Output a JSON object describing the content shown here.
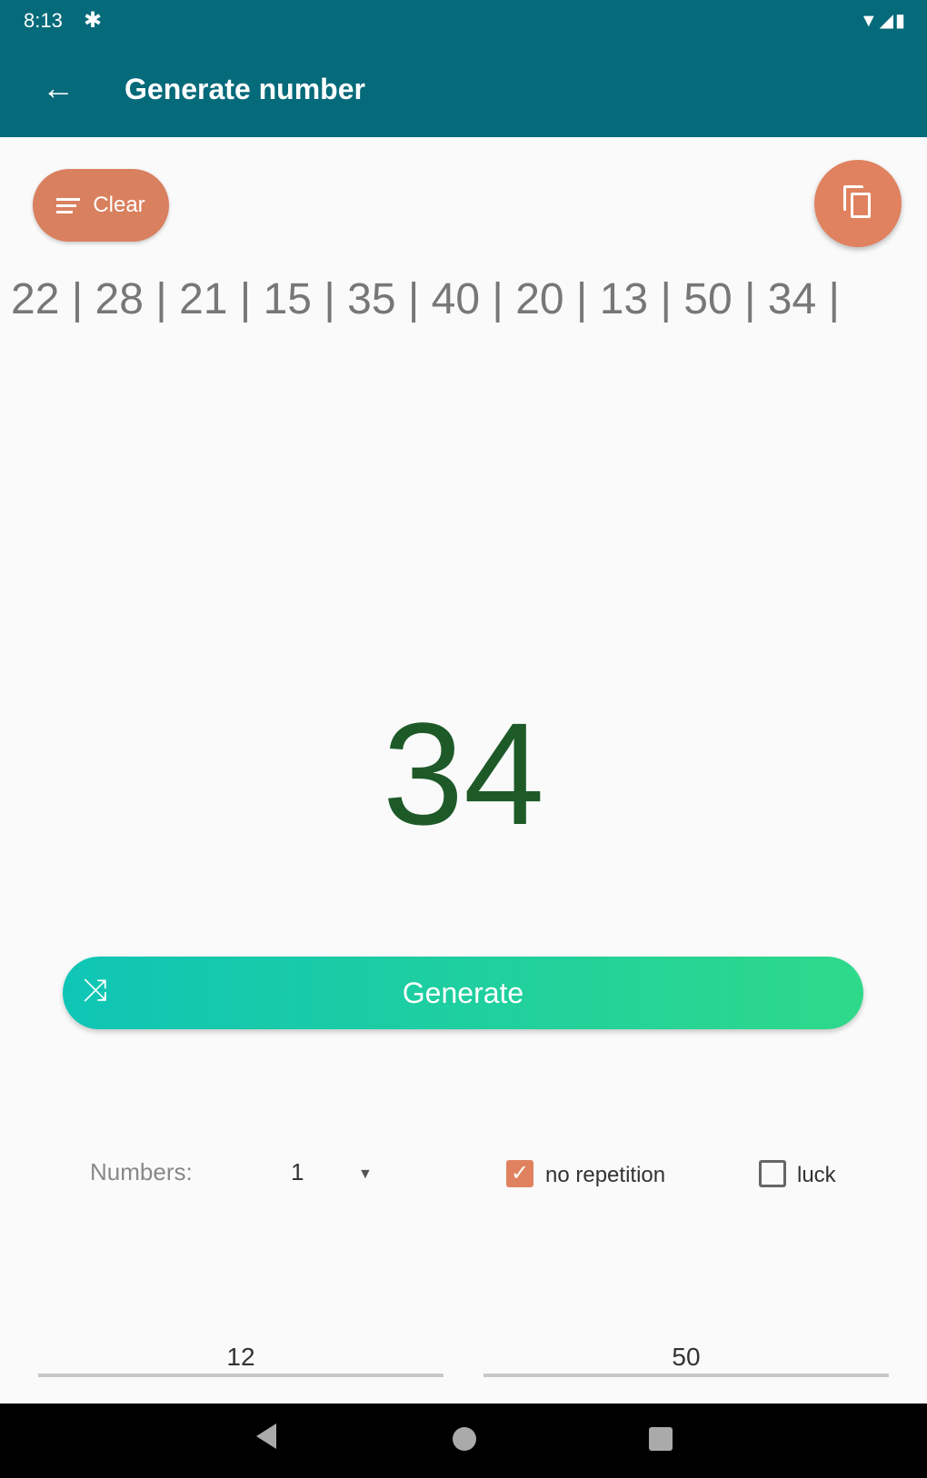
{
  "status_bar": {
    "time": "8:13",
    "icons": [
      "settings-icon",
      "wifi-icon",
      "signal-icon",
      "battery-icon"
    ]
  },
  "app_bar": {
    "title": "Generate number",
    "back_icon": "arrow-left-icon"
  },
  "clear_button": {
    "label": "Clear",
    "icon": "clear-all-icon"
  },
  "copy_button": {
    "icon": "copy-icon"
  },
  "history": "22 | 28 | 21 | 15 | 35 | 40 | 20 | 13 | 50 | 34 |",
  "result": "34",
  "generate_button": {
    "label": "Generate",
    "icon": "shuffle-icon"
  },
  "options": {
    "numbers_label": "Numbers:",
    "numbers_value": "1",
    "no_repetition": {
      "label": "no repetition",
      "checked": true
    },
    "luck": {
      "label": "luck",
      "checked": false
    }
  },
  "range": {
    "min": "12",
    "max": "50"
  },
  "colors": {
    "primary": "#056a7a",
    "accent": "#e0825f",
    "result": "#1e5a28",
    "gradient_start": "#0fc5b5",
    "gradient_end": "#2ed98a"
  }
}
